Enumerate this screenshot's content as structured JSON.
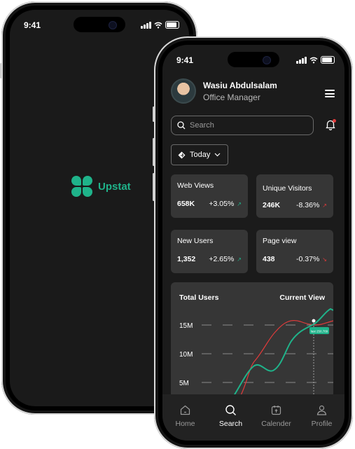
{
  "back_phone": {
    "status": {
      "time": "9:41"
    },
    "splash": {
      "brand_name": "Upstat",
      "brand_color": "#1fb38a"
    }
  },
  "front_phone": {
    "status": {
      "time": "9:41"
    },
    "profile": {
      "name": "Wasiu Abdulsalam",
      "role": "Office Manager"
    },
    "search": {
      "placeholder": "Search"
    },
    "filter": {
      "selected": "Today"
    },
    "stats": [
      {
        "title": "Web Views",
        "value": "658K",
        "change": "+3.05%",
        "trend": "up"
      },
      {
        "title": "Unique Visitors",
        "value": "246K",
        "change": "-8.36%",
        "trend": "down"
      },
      {
        "title": "New Users",
        "value": "1,352",
        "change": "+2.65%",
        "trend": "up"
      },
      {
        "title": "Page view",
        "value": "438",
        "change": "-0.37%",
        "trend": "down"
      }
    ],
    "chart": {
      "left_title": "Total Users",
      "right_title": "Current View",
      "y_ticks": [
        "15M",
        "10M",
        "5M"
      ],
      "tooltip": "last 250,789"
    },
    "nav": [
      {
        "label": "Home",
        "icon": "home-icon",
        "active": false
      },
      {
        "label": "Search",
        "icon": "search-icon",
        "active": true
      },
      {
        "label": "Calender",
        "icon": "calendar-icon",
        "active": false
      },
      {
        "label": "Profile",
        "icon": "profile-icon",
        "active": false
      }
    ],
    "colors": {
      "accent": "#1fb38a",
      "negative": "#e23b3b",
      "card": "#363636"
    }
  }
}
